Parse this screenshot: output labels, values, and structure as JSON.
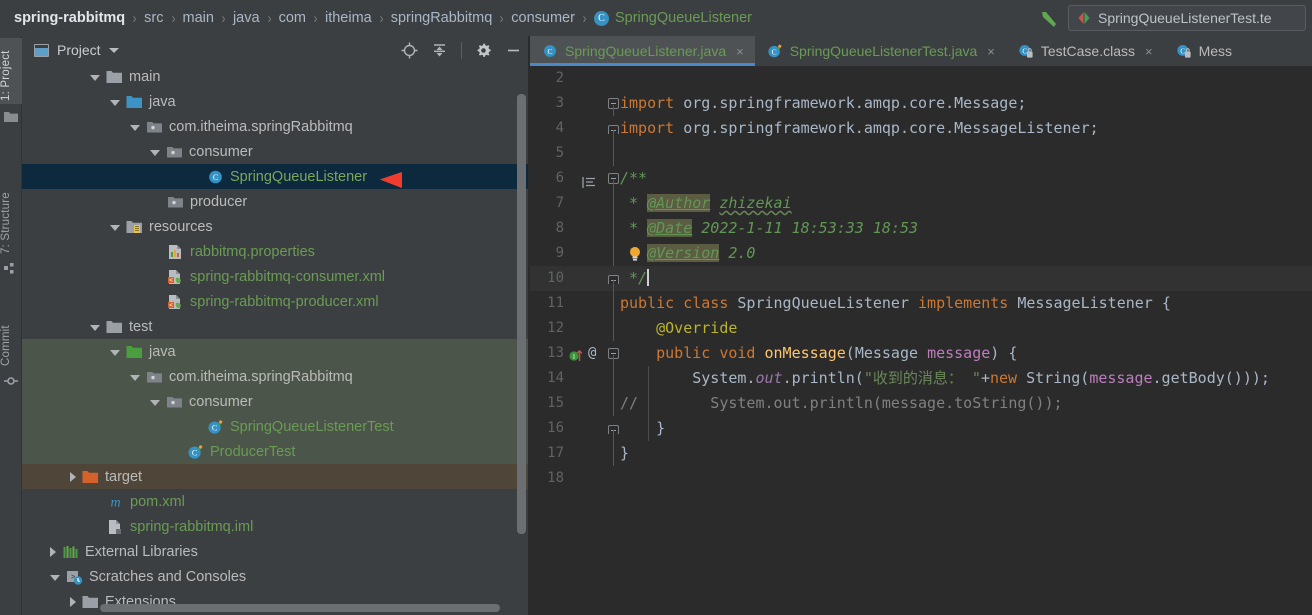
{
  "breadcrumb": {
    "items": [
      {
        "label": "spring-rabbitmq",
        "style": "bold"
      },
      {
        "label": "src",
        "style": "normal"
      },
      {
        "label": "main",
        "style": "normal"
      },
      {
        "label": "java",
        "style": "normal"
      },
      {
        "label": "com",
        "style": "normal"
      },
      {
        "label": "itheima",
        "style": "normal"
      },
      {
        "label": "springRabbitmq",
        "style": "normal"
      },
      {
        "label": "consumer",
        "style": "normal"
      },
      {
        "label": "SpringQueueListener",
        "style": "class"
      }
    ],
    "separator": "›"
  },
  "run_config": {
    "label": "SpringQueueListenerTest.te"
  },
  "left_strip": {
    "project": "1: Project",
    "structure": "7: Structure",
    "commit": "Commit"
  },
  "project_panel": {
    "title": "Project",
    "toolbar": {
      "locate": "locate-icon",
      "collapse_all": "collapse-all-icon",
      "settings": "gear-icon",
      "hide": "minimize-icon"
    },
    "tree": [
      {
        "label": "main",
        "indent": 3,
        "arrow": "open",
        "icon": "folder-grey",
        "zone": "main"
      },
      {
        "label": "java",
        "indent": 4,
        "arrow": "open",
        "icon": "folder-blue",
        "zone": "main"
      },
      {
        "label": "com.itheima.springRabbitmq",
        "indent": 5,
        "arrow": "open",
        "icon": "package",
        "zone": "main"
      },
      {
        "label": "consumer",
        "indent": 6,
        "arrow": "open",
        "icon": "package",
        "zone": "main"
      },
      {
        "label": "SpringQueueListener",
        "indent": 8,
        "arrow": "none",
        "icon": "java-class",
        "zone": "main",
        "selected": true
      },
      {
        "label": "producer",
        "indent": 6,
        "arrow": "none",
        "icon": "package",
        "zone": "main"
      },
      {
        "label": "resources",
        "indent": 4,
        "arrow": "open",
        "icon": "folder-res",
        "zone": "main"
      },
      {
        "label": "rabbitmq.properties",
        "indent": 6,
        "arrow": "none",
        "icon": "properties",
        "zone": "main",
        "green": true
      },
      {
        "label": "spring-rabbitmq-consumer.xml",
        "indent": 6,
        "arrow": "none",
        "icon": "spring-xml",
        "zone": "main",
        "green": true
      },
      {
        "label": "spring-rabbitmq-producer.xml",
        "indent": 6,
        "arrow": "none",
        "icon": "spring-xml",
        "zone": "main",
        "green": true
      },
      {
        "label": "test",
        "indent": 3,
        "arrow": "open",
        "icon": "folder-grey",
        "zone": "main"
      },
      {
        "label": "java",
        "indent": 4,
        "arrow": "open",
        "icon": "folder-green",
        "zone": "test"
      },
      {
        "label": "com.itheima.springRabbitmq",
        "indent": 5,
        "arrow": "open",
        "icon": "package",
        "zone": "test"
      },
      {
        "label": "consumer",
        "indent": 6,
        "arrow": "open",
        "icon": "package",
        "zone": "test"
      },
      {
        "label": "SpringQueueListenerTest",
        "indent": 8,
        "arrow": "none",
        "icon": "java-test",
        "zone": "test",
        "green": true
      },
      {
        "label": "ProducerTest",
        "indent": 7,
        "arrow": "none",
        "icon": "java-test",
        "zone": "test",
        "green": true
      },
      {
        "label": "target",
        "indent": 2,
        "arrow": "closed",
        "icon": "folder-orange",
        "zone": "target"
      },
      {
        "label": "pom.xml",
        "indent": 3,
        "arrow": "none",
        "icon": "maven",
        "zone": "main",
        "green": true
      },
      {
        "label": "spring-rabbitmq.iml",
        "indent": 3,
        "arrow": "none",
        "icon": "iml",
        "zone": "main",
        "green": true
      },
      {
        "label": "External Libraries",
        "indent": 1,
        "arrow": "closed",
        "icon": "libraries",
        "zone": "main"
      },
      {
        "label": "Scratches and Consoles",
        "indent": 1,
        "arrow": "open",
        "icon": "scratches",
        "zone": "main"
      },
      {
        "label": "Extensions",
        "indent": 2,
        "arrow": "closed",
        "icon": "folder-grey",
        "zone": "main"
      }
    ]
  },
  "editor": {
    "tabs": [
      {
        "label": "SpringQueueListener.java",
        "icon": "java-class",
        "active": true,
        "green": true,
        "close": "×"
      },
      {
        "label": "SpringQueueListenerTest.java",
        "icon": "java-test",
        "active": false,
        "green": true,
        "close": "×"
      },
      {
        "label": "TestCase.class",
        "icon": "class-file",
        "active": false,
        "green": false,
        "close": "×"
      },
      {
        "label": "Mess",
        "icon": "class-file",
        "active": false,
        "green": false,
        "close": ""
      }
    ],
    "lines": [
      {
        "n": "2",
        "fold": "",
        "text": ""
      },
      {
        "n": "3",
        "fold": "open",
        "text": "import org.springframework.amqp.core.Message;"
      },
      {
        "n": "4",
        "fold": "endcap",
        "text": "import org.springframework.amqp.core.MessageListener;"
      },
      {
        "n": "5",
        "fold": "",
        "text": ""
      },
      {
        "n": "6",
        "fold": "open",
        "text": "/**"
      },
      {
        "n": "7",
        "fold": "",
        "text": " * @Author zhizekai"
      },
      {
        "n": "8",
        "fold": "",
        "text": " * @Date 2022-1-11 18:53:33 18:53"
      },
      {
        "n": "9",
        "fold": "",
        "text": " * @Version 2.0"
      },
      {
        "n": "10",
        "fold": "endcap",
        "text": " */"
      },
      {
        "n": "11",
        "fold": "",
        "text": "public class SpringQueueListener implements MessageListener {"
      },
      {
        "n": "12",
        "fold": "",
        "text": "    @Override"
      },
      {
        "n": "13",
        "fold": "open",
        "text": "    public void onMessage(Message message) {"
      },
      {
        "n": "14",
        "fold": "",
        "text": "        System.out.println(\"收到的消息： \"+new String(message.getBody()));"
      },
      {
        "n": "15",
        "fold": "",
        "text": "//        System.out.println(message.toString());"
      },
      {
        "n": "16",
        "fold": "endcap",
        "text": "    }"
      },
      {
        "n": "17",
        "fold": "",
        "text": "}"
      },
      {
        "n": "18",
        "fold": "",
        "text": ""
      }
    ],
    "gutter_line13": {
      "implements_marker": "implementing-method-icon",
      "override_marker": "override-annotation-icon"
    },
    "javadoc": {
      "author_tag": "@Author",
      "author_value": "zhizekai",
      "date_tag": "@Date",
      "date_value": "2022-1-11 18:53:33 18:53",
      "version_tag": "@Version",
      "version_value": "2.0",
      "bulb": "intention-bulb-icon"
    }
  },
  "annotation": {
    "arrow": "red-pointer-arrow"
  },
  "colors": {
    "panel_bg": "#3c3f41",
    "editor_bg": "#2b2b2b",
    "selection": "#0d293e",
    "test_root": "#4c5549",
    "target_root": "#4f4639",
    "green_text": "#6a9b54",
    "accent_blue": "#4a88c7",
    "arrow_red": "#f03c2e"
  }
}
